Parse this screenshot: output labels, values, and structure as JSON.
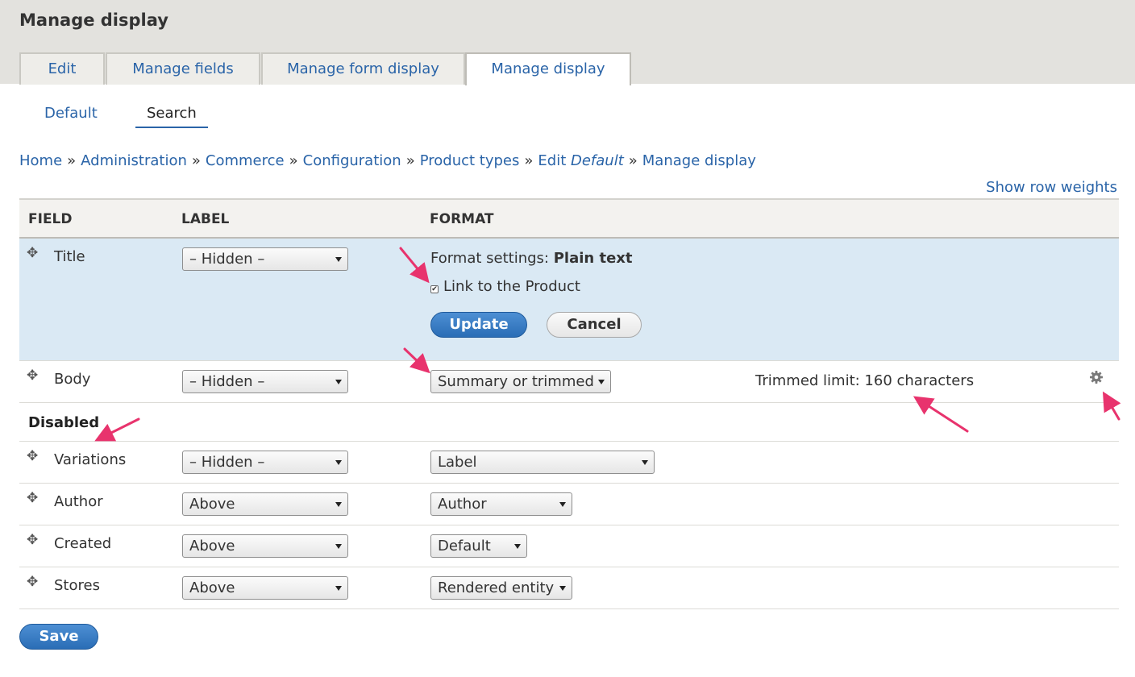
{
  "page": {
    "title": "Manage display"
  },
  "tabs": [
    {
      "label": "Edit"
    },
    {
      "label": "Manage fields"
    },
    {
      "label": "Manage form display"
    },
    {
      "label": "Manage display"
    }
  ],
  "subtabs": [
    {
      "label": "Default"
    },
    {
      "label": "Search"
    }
  ],
  "breadcrumb": {
    "items": [
      "Home",
      "Administration",
      "Commerce",
      "Configuration",
      "Product types"
    ],
    "edit_prefix": "Edit",
    "edit_name": "Default",
    "last": "Manage display",
    "separator": "»"
  },
  "show_row_weights": "Show row weights",
  "table": {
    "headers": {
      "field": "FIELD",
      "label": "LABEL",
      "format": "FORMAT"
    },
    "drag_handle": "✥",
    "title_row": {
      "name": "Title",
      "label_value": "– Hidden –",
      "format_settings_prefix": "Format settings:",
      "format_settings_name": "Plain text",
      "checkbox_label": "Link to the Product",
      "checkbox_checked": true,
      "update_label": "Update",
      "cancel_label": "Cancel"
    },
    "body_row": {
      "name": "Body",
      "label_value": "– Hidden –",
      "format_value": "Summary or trimmed",
      "summary": "Trimmed limit: 160 characters",
      "settings_icon": "gear-icon"
    },
    "disabled_label": "Disabled",
    "disabled_rows": [
      {
        "name": "Variations",
        "label_value": "– Hidden –",
        "format_value": "Label"
      },
      {
        "name": "Author",
        "label_value": "Above",
        "format_value": "Author"
      },
      {
        "name": "Created",
        "label_value": "Above",
        "format_value": "Default"
      },
      {
        "name": "Stores",
        "label_value": "Above",
        "format_value": "Rendered entity"
      }
    ]
  },
  "save_label": "Save",
  "colors": {
    "link": "#2a64a8",
    "header_bg": "#e3e2de",
    "highlight_row": "#dae9f4",
    "primary_button": "#2a6db6",
    "annotation_arrow": "#e8336d"
  }
}
